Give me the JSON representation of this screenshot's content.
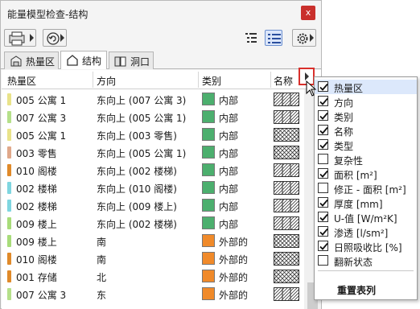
{
  "window": {
    "title": "能量模型检查-结构",
    "close_label": "x"
  },
  "tabs": [
    {
      "label": "热量区",
      "icon": "zone-icon",
      "active": false
    },
    {
      "label": "结构",
      "icon": "house-icon",
      "active": true
    },
    {
      "label": "洞口",
      "icon": "opening-icon",
      "active": false
    }
  ],
  "columns": [
    "热量区",
    "方向",
    "类别",
    "名称"
  ],
  "rows": [
    {
      "zone": "005 公寓 1",
      "direction": "东向上 (007 公寓 3)",
      "category": "内部",
      "zone_color": "#e9e38a",
      "cat_color": "#4caf6e",
      "pattern": "hatch"
    },
    {
      "zone": "007 公寓 3",
      "direction": "东向上 (005 公寓 1)",
      "category": "内部",
      "zone_color": "#b5e08a",
      "cat_color": "#4caf6e",
      "pattern": "hatch"
    },
    {
      "zone": "005 公寓 1",
      "direction": "东向上 (003 零售)",
      "category": "内部",
      "zone_color": "#e9e38a",
      "cat_color": "#4caf6e",
      "pattern": "cross"
    },
    {
      "zone": "003 零售",
      "direction": "东向上 (005 公寓 1)",
      "category": "内部",
      "zone_color": "#e0a88a",
      "cat_color": "#4caf6e",
      "pattern": "cross"
    },
    {
      "zone": "010 阁楼",
      "direction": "东向上 (002 楼梯)",
      "category": "内部",
      "zone_color": "#e08a2a",
      "cat_color": "#4caf6e",
      "pattern": "hatch"
    },
    {
      "zone": "002 楼梯",
      "direction": "东向上 (010 阁楼)",
      "category": "内部",
      "zone_color": "#7fd6e0",
      "cat_color": "#4caf6e",
      "pattern": "hatch"
    },
    {
      "zone": "002 楼梯",
      "direction": "东向上 (009  楼上)",
      "category": "内部",
      "zone_color": "#7fd6e0",
      "cat_color": "#4caf6e",
      "pattern": "hatch"
    },
    {
      "zone": "009  楼上",
      "direction": "东向上 (002 楼梯)",
      "category": "内部",
      "zone_color": "#a8dc7a",
      "cat_color": "#4caf6e",
      "pattern": "hatch"
    },
    {
      "zone": "009  楼上",
      "direction": "南",
      "category": "外部的",
      "zone_color": "#a8dc7a",
      "cat_color": "#f08a2a",
      "pattern": "cross"
    },
    {
      "zone": "010 阁楼",
      "direction": "南",
      "category": "外部的",
      "zone_color": "#e08a2a",
      "cat_color": "#f08a2a",
      "pattern": "cross"
    },
    {
      "zone": "001 存储",
      "direction": "北",
      "category": "外部的",
      "zone_color": "#e08a2a",
      "cat_color": "#f08a2a",
      "pattern": "cross"
    },
    {
      "zone": "007 公寓 3",
      "direction": "东",
      "category": "外部的",
      "zone_color": "#b5e08a",
      "cat_color": "#f08a2a",
      "pattern": "hatch"
    }
  ],
  "menu": {
    "items": [
      {
        "label": "热量区",
        "checked": true,
        "highlighted": true
      },
      {
        "label": "方向",
        "checked": true
      },
      {
        "label": "类别",
        "checked": true
      },
      {
        "label": "名称",
        "checked": true
      },
      {
        "label": "类型",
        "checked": true
      },
      {
        "label": "复杂性",
        "checked": false
      },
      {
        "label": "面积 [m²]",
        "checked": true
      },
      {
        "label": "修正 - 面积 [m²]",
        "checked": false
      },
      {
        "label": "厚度 [mm]",
        "checked": true
      },
      {
        "label": "U-值 [W/m²K]",
        "checked": true
      },
      {
        "label": "渗透 [l/sm²]",
        "checked": true
      },
      {
        "label": "日照吸收比 [%]",
        "checked": true
      },
      {
        "label": "翻新状态",
        "checked": false
      }
    ],
    "reset_label": "重置表列"
  }
}
